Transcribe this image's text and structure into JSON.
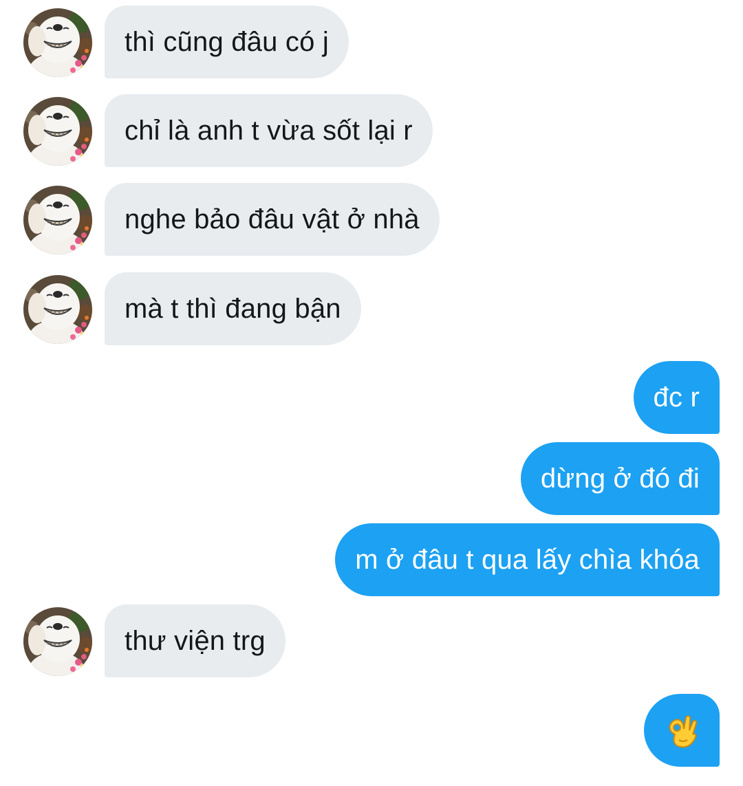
{
  "conversation": {
    "messages": [
      {
        "sender": "contact",
        "text": "thì cũng đâu có j"
      },
      {
        "sender": "contact",
        "text": "chỉ là anh t vừa sốt lại r"
      },
      {
        "sender": "contact",
        "text": "nghe bảo đâu vật ở nhà"
      },
      {
        "sender": "contact",
        "text": "mà t thì đang bận"
      },
      {
        "sender": "me",
        "text": "đc r"
      },
      {
        "sender": "me",
        "text": "dừng ở đó đi"
      },
      {
        "sender": "me",
        "text": "m ở đâu t qua lấy chìa khóa"
      },
      {
        "sender": "contact",
        "text": "thư viện trg"
      },
      {
        "sender": "me",
        "emoji": "ok-hand-icon"
      }
    ]
  },
  "colors": {
    "incoming_bubble": "#e8ecef",
    "incoming_text": "#14171a",
    "outgoing_bubble": "#1da1f2",
    "outgoing_text": "#ffffff"
  },
  "avatar": {
    "icon": "smiling-dog-avatar"
  }
}
